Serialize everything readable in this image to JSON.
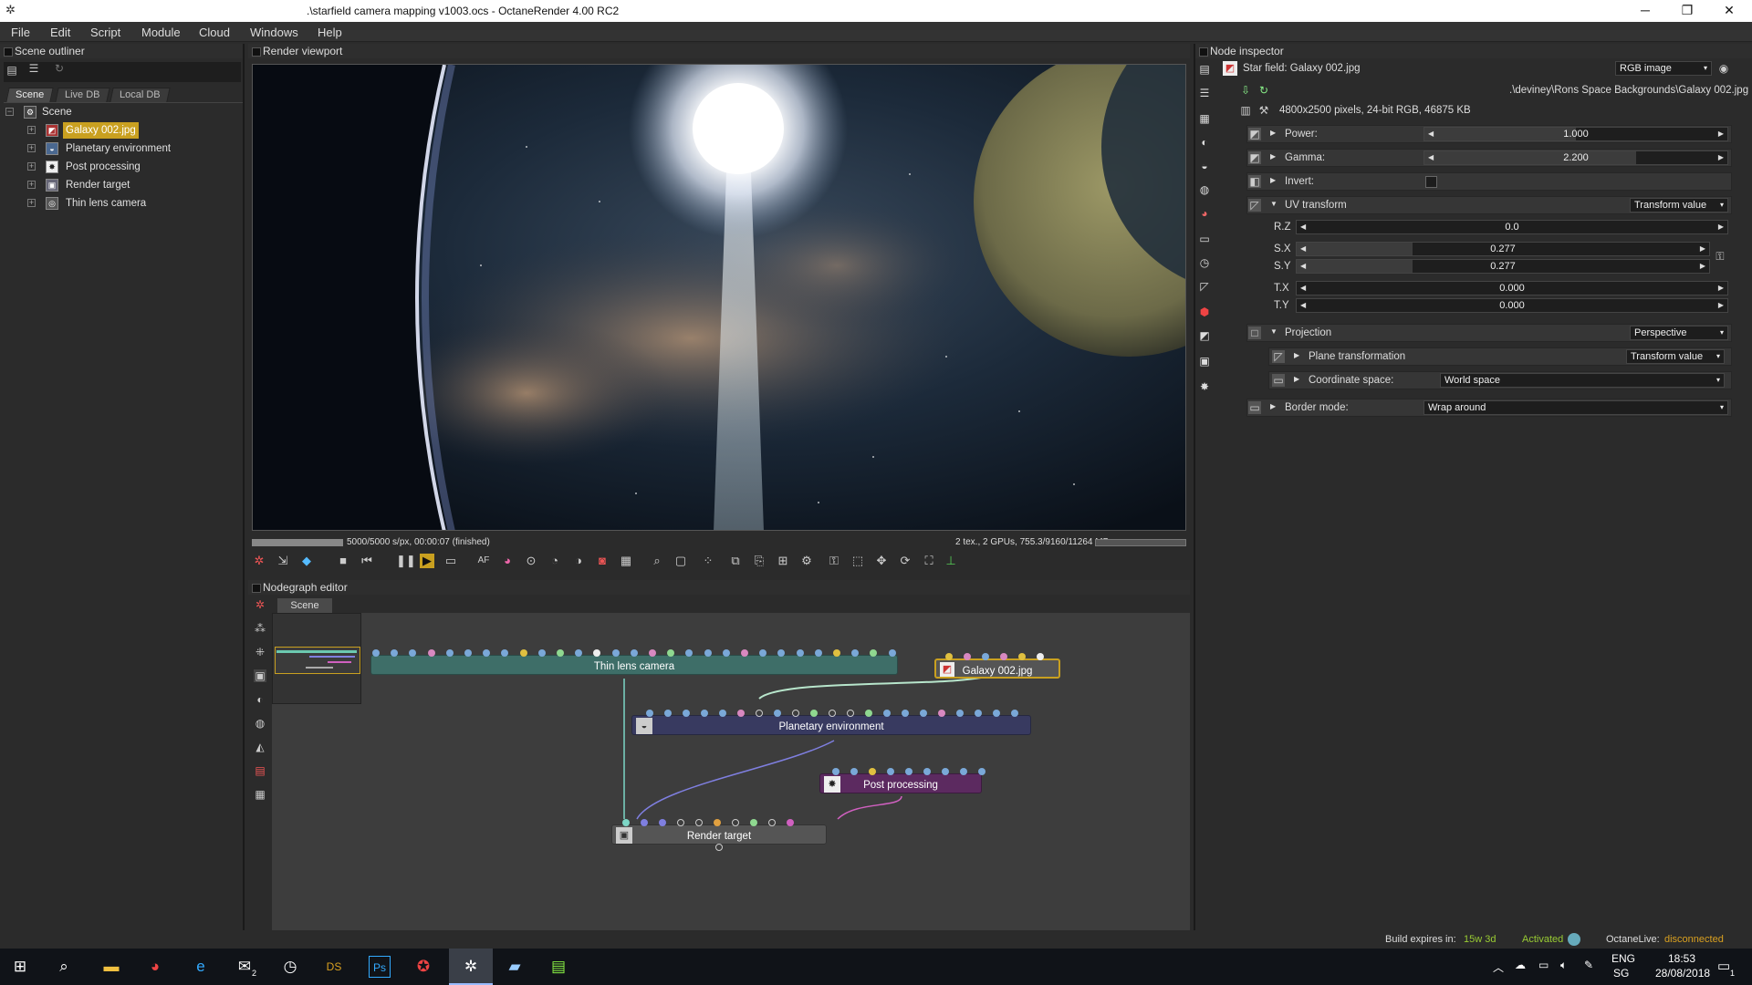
{
  "window": {
    "title": ".\\starfield camera mapping v1003.ocs - OctaneRender 4.00 RC2",
    "minimize": "─",
    "maximize": "❐",
    "close": "✕"
  },
  "menu": [
    "File",
    "Edit",
    "Script",
    "Module",
    "Cloud",
    "Windows",
    "Help"
  ],
  "outliner": {
    "title": "Scene outliner",
    "tabs": [
      "Scene",
      "Live DB",
      "Local DB"
    ],
    "root": "Scene",
    "items": [
      {
        "label": "Galaxy 002.jpg",
        "selected": true
      },
      {
        "label": "Planetary environment"
      },
      {
        "label": "Post processing"
      },
      {
        "label": "Render target"
      },
      {
        "label": "Thin lens camera"
      }
    ]
  },
  "viewport": {
    "title": "Render viewport",
    "status_left": "5000/5000 s/px, 00:00:07 (finished)",
    "status_right": "2 tex., 2 GPUs, 755.3/9160/11264 MB",
    "progress": 1.0
  },
  "nodegraph": {
    "title": "Nodegraph editor",
    "tab": "Scene",
    "nodes": {
      "camera": "Thin lens camera",
      "galaxy": "Galaxy 002.jpg",
      "env": "Planetary environment",
      "post": "Post processing",
      "target": "Render target"
    }
  },
  "inspector": {
    "title": "Node inspector",
    "node_name": "Star field: Galaxy 002.jpg",
    "node_type": "RGB image",
    "file_path": ".\\deviney\\Rons Space Backgrounds\\Galaxy 002.jpg",
    "file_info": "4800x2500 pixels, 24-bit RGB, 46875 KB",
    "power": {
      "label": "Power:",
      "value": "1.000",
      "fraction": 0.5
    },
    "gamma": {
      "label": "Gamma:",
      "value": "2.200",
      "fraction": 0.7
    },
    "invert": {
      "label": "Invert:",
      "checked": false
    },
    "uv": {
      "label": "UV transform",
      "mode": "Transform value",
      "rz": {
        "label": "R.Z",
        "value": "0.0"
      },
      "sx": {
        "label": "S.X",
        "value": "0.277",
        "fraction": 0.28
      },
      "sy": {
        "label": "S.Y",
        "value": "0.277",
        "fraction": 0.28
      },
      "tx": {
        "label": "T.X",
        "value": "0.000"
      },
      "ty": {
        "label": "T.Y",
        "value": "0.000"
      }
    },
    "projection": {
      "label": "Projection",
      "mode": "Perspective",
      "plane_label": "Plane transformation",
      "plane_mode": "Transform value",
      "coord_label": "Coordinate space:",
      "coord_value": "World space"
    },
    "border": {
      "label": "Border mode:",
      "value": "Wrap around"
    }
  },
  "build": {
    "expires_label": "Build expires in:",
    "expires_value": "15w 3d",
    "activated": "Activated",
    "live_label": "OctaneLive:",
    "live_value": "disconnected"
  },
  "taskbar": {
    "lang1": "ENG",
    "lang2": "SG",
    "time": "18:53",
    "date": "28/08/2018",
    "notif": "1",
    "mail_badge": "2"
  }
}
